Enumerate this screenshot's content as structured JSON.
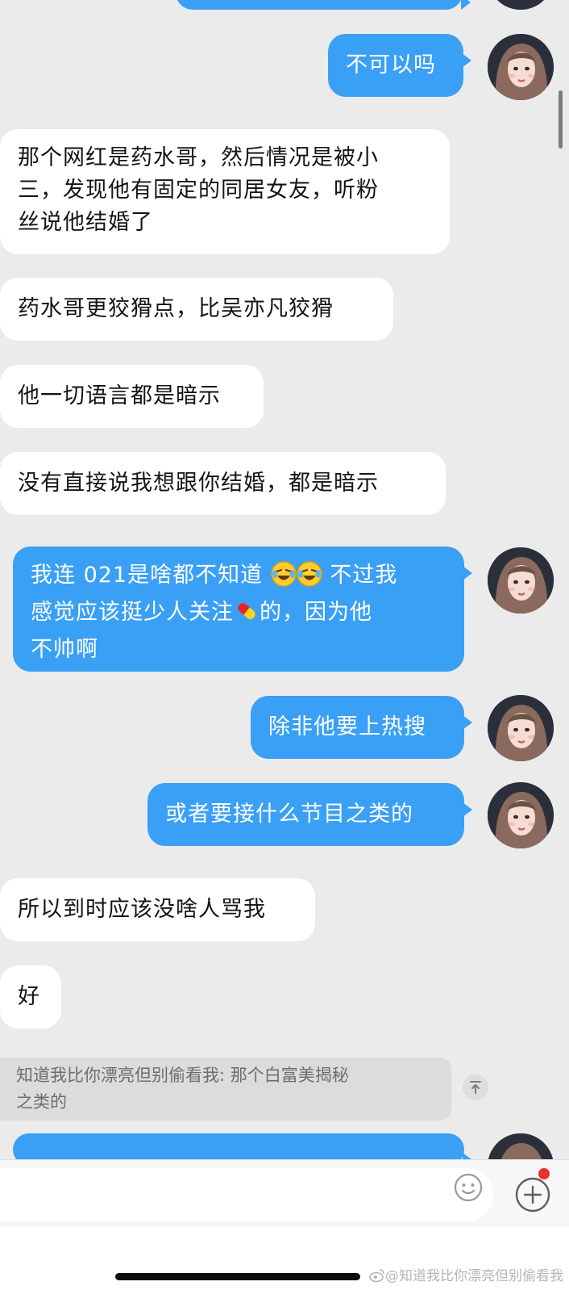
{
  "messages": [
    {
      "side": "out",
      "text": "不可以吗"
    },
    {
      "side": "in",
      "lines": [
        "那个网红是药水哥，然后情况是被小",
        "三，发现他有固定的同居女友，听粉",
        "丝说他结婚了"
      ]
    },
    {
      "side": "in",
      "text": "药水哥更狡猾点，比吴亦凡狡猾"
    },
    {
      "side": "in",
      "text": "他一切语言都是暗示"
    },
    {
      "side": "in",
      "text": "没有直接说我想跟你结婚，都是暗示"
    },
    {
      "side": "out",
      "part1": "我连 021是啥都不知道",
      "part2": " 不过我",
      "line2a": "感觉应该挺少人关注",
      "line2b": "的，因为他",
      "line3": "不帅啊",
      "emojis": [
        "laughing-crying-emoji",
        "laughing-crying-emoji",
        "pill-emoji"
      ]
    },
    {
      "side": "out",
      "text": "除非他要上热搜"
    },
    {
      "side": "out",
      "text": "或者要接什么节目之类的"
    },
    {
      "side": "in",
      "text": "所以到时应该没啥人骂我"
    },
    {
      "side": "in",
      "text": "好"
    }
  ],
  "quote": {
    "line1": "知道我比你漂亮但别偷看我: 那个白富美揭秘",
    "line2": "之类的"
  },
  "watermark": "@知道我比你漂亮但别偷看我",
  "colors": {
    "outgoing": "#3aa0f5",
    "incoming": "#ffffff",
    "background": "#ebebeb",
    "badge": "#e9302c"
  },
  "icons": [
    "emoji-icon",
    "plus-icon",
    "scroll-top-icon",
    "weibo-logo-icon"
  ]
}
